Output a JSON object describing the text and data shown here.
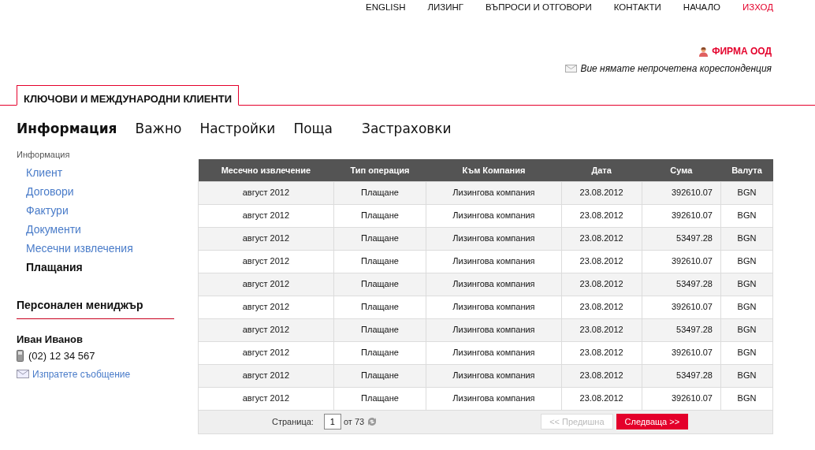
{
  "top_menu": [
    {
      "label": "ENGLISH",
      "kind": "link"
    },
    {
      "label": "ЛИЗИНГ",
      "kind": "link"
    },
    {
      "label": "ВЪПРОСИ И ОТГОВОРИ",
      "kind": "link"
    },
    {
      "label": "КОНТАКТИ",
      "kind": "link"
    },
    {
      "label": "НАЧАЛО",
      "kind": "link"
    },
    {
      "label": "ИЗХОД",
      "kind": "exit"
    }
  ],
  "user": {
    "company": "ФИРМА ООД",
    "messages": "Вие нямате непрочетена кореспонденция"
  },
  "section_tab": {
    "label": "КЛЮЧОВИ И МЕЖДУНАРОДНИ КЛИЕНТИ"
  },
  "main_nav": [
    {
      "label": "Информация",
      "selected": true
    },
    {
      "label": "Важно",
      "selected": false
    },
    {
      "label": "Настройки",
      "selected": false
    },
    {
      "label": "Поща",
      "selected": false
    },
    {
      "label": "Застраховки",
      "selected": false
    }
  ],
  "sidebar": {
    "heading": "Информация",
    "items": [
      {
        "label": "Клиент",
        "selected": false
      },
      {
        "label": "Договори",
        "selected": false
      },
      {
        "label": "Фактури",
        "selected": false
      },
      {
        "label": "Документи",
        "selected": false
      },
      {
        "label": "Месечни извлечения",
        "selected": false
      },
      {
        "label": "Плащания",
        "selected": true
      }
    ]
  },
  "manager": {
    "heading": "Персонален мениджър",
    "name": "Иван Иванов",
    "phone": "(02) 12 34 567",
    "message_link": "Изпратете съобщение"
  },
  "table": {
    "columns": [
      "Месечно извлечение",
      "Тип операция",
      "Към Компания",
      "Дата",
      "Сума",
      "Валута"
    ],
    "rows": [
      [
        "август 2012",
        "Плащане",
        "Лизингова компания",
        "23.08.2012",
        "392610.07",
        "BGN"
      ],
      [
        "август 2012",
        "Плащане",
        "Лизингова компания",
        "23.08.2012",
        "392610.07",
        "BGN"
      ],
      [
        "август 2012",
        "Плащане",
        "Лизингова компания",
        "23.08.2012",
        "53497.28",
        "BGN"
      ],
      [
        "август 2012",
        "Плащане",
        "Лизингова компания",
        "23.08.2012",
        "392610.07",
        "BGN"
      ],
      [
        "август 2012",
        "Плащане",
        "Лизингова компания",
        "23.08.2012",
        "53497.28",
        "BGN"
      ],
      [
        "август 2012",
        "Плащане",
        "Лизингова компания",
        "23.08.2012",
        "392610.07",
        "BGN"
      ],
      [
        "август 2012",
        "Плащане",
        "Лизингова компания",
        "23.08.2012",
        "53497.28",
        "BGN"
      ],
      [
        "август 2012",
        "Плащане",
        "Лизингова компания",
        "23.08.2012",
        "392610.07",
        "BGN"
      ],
      [
        "август 2012",
        "Плащане",
        "Лизингова компания",
        "23.08.2012",
        "53497.28",
        "BGN"
      ],
      [
        "август 2012",
        "Плащане",
        "Лизингова компания",
        "23.08.2012",
        "392610.07",
        "BGN"
      ]
    ]
  },
  "pager": {
    "label": "Страница:",
    "page": "1",
    "of": "от 73",
    "prev": {
      "label": "<< Предишна",
      "disabled": true
    },
    "next": {
      "label": "Следваща >>",
      "disabled": false
    }
  }
}
